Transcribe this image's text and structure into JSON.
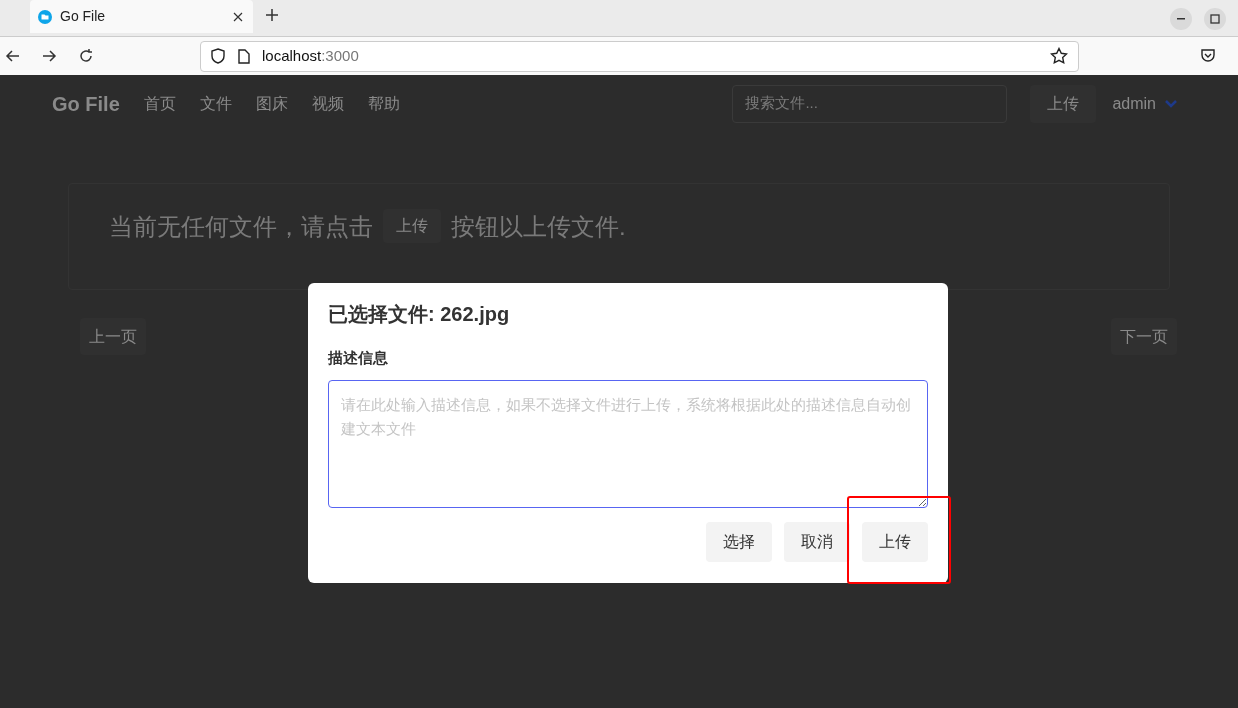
{
  "browser": {
    "tab": {
      "title": "Go File",
      "selected": true
    },
    "url": {
      "host": "localhost",
      "port": ":3000"
    }
  },
  "header": {
    "brand": "Go File",
    "nav": [
      "首页",
      "文件",
      "图床",
      "视频",
      "帮助"
    ],
    "search": {
      "placeholder": "搜索文件..."
    },
    "upload_button": "上传",
    "user_menu": "admin"
  },
  "empty_state": {
    "text_before": "当前无任何文件，请点击",
    "button": "上传",
    "text_after": "按钮以上传文件."
  },
  "pagination": {
    "previous": "上一页",
    "next": "下一页"
  },
  "dialog": {
    "title": "已选择文件: 262.jpg",
    "field_label": "描述信息",
    "description": {
      "placeholder": "请在此处输入描述信息，如果不选择文件进行上传，系统将根据此处的描述信息自动创建文本文件"
    },
    "buttons": [
      "选择",
      "取消",
      "上传"
    ]
  }
}
